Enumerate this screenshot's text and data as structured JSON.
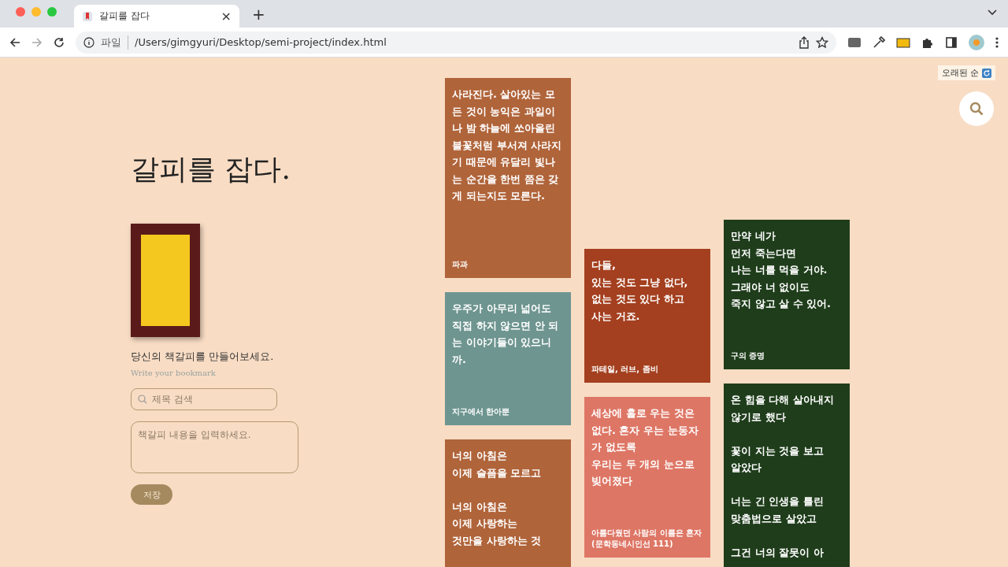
{
  "browser": {
    "tab_title": "갈피를 잡다",
    "close_glyph": "×",
    "new_tab_glyph": "+",
    "scheme_label": "파일",
    "url": "/Users/gimgyuri/Desktop/semi-project/index.html"
  },
  "sort_button": {
    "label": "오래된 순"
  },
  "hero": {
    "title": "갈피를 잡다.",
    "prompt": "당신의 책갈피를 만들어보세요.",
    "subtitle": "Write your bookmark"
  },
  "form": {
    "title_placeholder": "제목 검색",
    "content_placeholder": "책갈피 내용을 입력하세요.",
    "save_label": "저장"
  },
  "columns": [
    {
      "cards": [
        {
          "color": "#b0643a",
          "quote": "사라진다. 살아있는 모든 것이 농익은 과일이나 밤 하늘에 쏘아올린 불꽃처럼 부서져 사라지기 때문에 유달리 빛나는 순간을 한번 쯤은 갖게 되는지도 모른다.",
          "source": "파과"
        },
        {
          "color": "#6e9590",
          "quote": "우주가 아무리 넓어도 직접 하지 않으면 안 되는 이야기들이 있으니까.",
          "source": "지구에서 한아뿐"
        },
        {
          "color": "#b0643a",
          "quote": "너의 아침은\n이제 슬픔을 모르고\n\n너의 아침은\n이제 사랑하는\n것만을 사랑하는 것"
        }
      ]
    },
    {
      "cards": [
        {
          "color": "#a4401f",
          "quote": "다들,\n있는 것도 그냥 없다,\n없는 것도 있다 하고\n사는 거죠.",
          "source": "파테일, 러브, 좀비"
        },
        {
          "color": "#de7665",
          "quote": "세상에 홀로 우는 것은 없다. 혼자 우는 눈동자가 없도록\n우리는 두 개의 눈으로 빚어졌다",
          "source": "아름다웠던 사람의 이름은 혼자(문학동네시인선 111)"
        }
      ]
    },
    {
      "cards": [
        {
          "color": "#1f3d1b",
          "quote": "만약 네가\n먼저 죽는다면\n나는 너를 먹을 거야.\n그래야 너 없이도\n죽지 않고 살 수 있어.",
          "source": "구의 증명"
        },
        {
          "color": "#1f3d1b",
          "quote": "온 힘을 다해 살아내지 않기로 했다\n\n꽃이 지는 것을 보고\n알았다\n\n너는 긴 인생을 틀린\n맞춤법으로 살았고\n\n그건 너의 잘못이 아"
        }
      ]
    }
  ]
}
